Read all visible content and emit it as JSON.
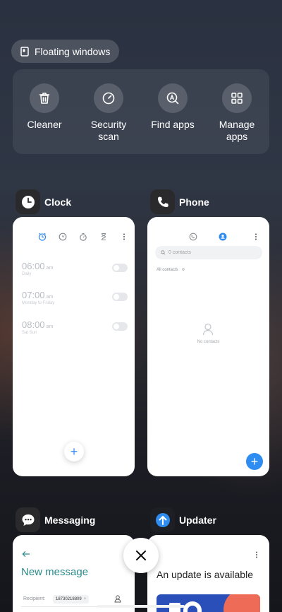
{
  "floating_windows": {
    "label": "Floating windows",
    "icon": "floating-window-icon"
  },
  "tools": [
    {
      "label": "Cleaner",
      "icon": "trash-icon"
    },
    {
      "label": "Security scan",
      "icon": "security-scan-icon"
    },
    {
      "label": "Find apps",
      "icon": "find-apps-icon"
    },
    {
      "label": "Manage apps",
      "icon": "grid-icon"
    }
  ],
  "apps": {
    "clock": {
      "name": "Clock",
      "alarms": [
        {
          "time": "06:00",
          "ampm": "am",
          "repeat": "Daily"
        },
        {
          "time": "07:00",
          "ampm": "am",
          "repeat": "Monday to Friday"
        },
        {
          "time": "08:00",
          "ampm": "am",
          "repeat": "Sat Sun"
        }
      ]
    },
    "phone": {
      "name": "Phone",
      "search_placeholder": "0 contacts",
      "filter": "All contacts",
      "empty": "No contacts"
    },
    "messaging": {
      "name": "Messaging",
      "title": "New message",
      "recipient_label": "Recipient:",
      "recipient_value": "18730218809"
    },
    "updater": {
      "name": "Updater",
      "message": "An update is available"
    }
  },
  "colors": {
    "accent_blue": "#2f8cf0",
    "messaging_teal": "#2b8a8a"
  }
}
